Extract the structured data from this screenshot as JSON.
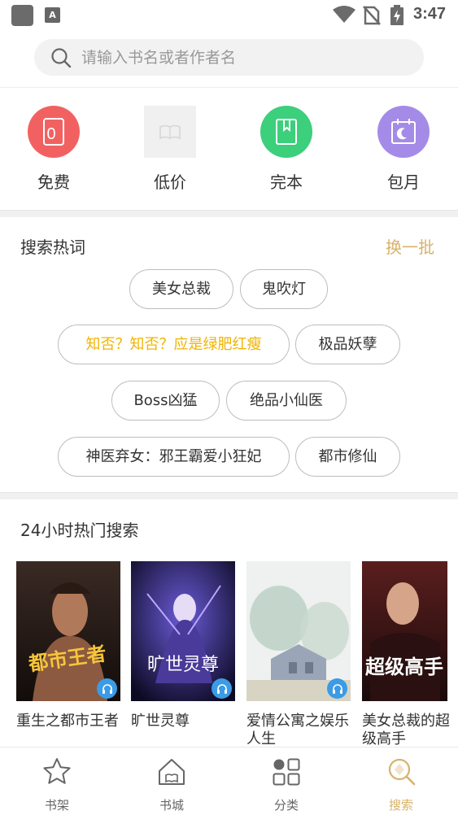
{
  "status_bar": {
    "time": "3:47",
    "a_icon": "A"
  },
  "search": {
    "placeholder": "请输入书名或者作者名"
  },
  "categories": [
    {
      "label": "免费",
      "icon": "free-icon",
      "color": "#f26161",
      "glyph": "0"
    },
    {
      "label": "低价",
      "icon": "low-price-icon",
      "color": "#f0f0f0"
    },
    {
      "label": "完本",
      "icon": "finished-book-icon",
      "color": "#3ccf7c"
    },
    {
      "label": "包月",
      "icon": "monthly-calendar-icon",
      "color": "#a58be8"
    }
  ],
  "hot_words": {
    "title": "搜索热词",
    "refresh": "换一批",
    "tags": [
      {
        "label": "美女总裁"
      },
      {
        "label": "鬼吹灯"
      },
      {
        "label": "知否？知否？应是绿肥红瘦"
      },
      {
        "label": "极品妖孽"
      },
      {
        "label": "Boss凶猛"
      },
      {
        "label": "绝品小仙医"
      },
      {
        "label": "神医弃女：邪王霸爱小狂妃"
      },
      {
        "label": "都市修仙"
      }
    ]
  },
  "hot_search": {
    "title": "24小时热门搜索",
    "books": [
      {
        "title": "重生之都市王者",
        "cover_text": "都市王者"
      },
      {
        "title": "旷世灵尊",
        "cover_text": "旷世灵尊"
      },
      {
        "title": "爱情公寓之娱乐人生"
      },
      {
        "title": "美女总裁的超级高手",
        "cover_text": "超级高手"
      }
    ]
  },
  "bottom_nav": [
    {
      "label": "书架",
      "icon": "bookshelf-star-icon"
    },
    {
      "label": "书城",
      "icon": "bookstore-house-icon"
    },
    {
      "label": "分类",
      "icon": "category-grid-icon"
    },
    {
      "label": "搜索",
      "icon": "search-tab-icon",
      "active": true
    }
  ],
  "colors": {
    "accent": "#d8b26a",
    "highlight_tag": "#f0b400",
    "audio_badge": "#3b9be6"
  }
}
